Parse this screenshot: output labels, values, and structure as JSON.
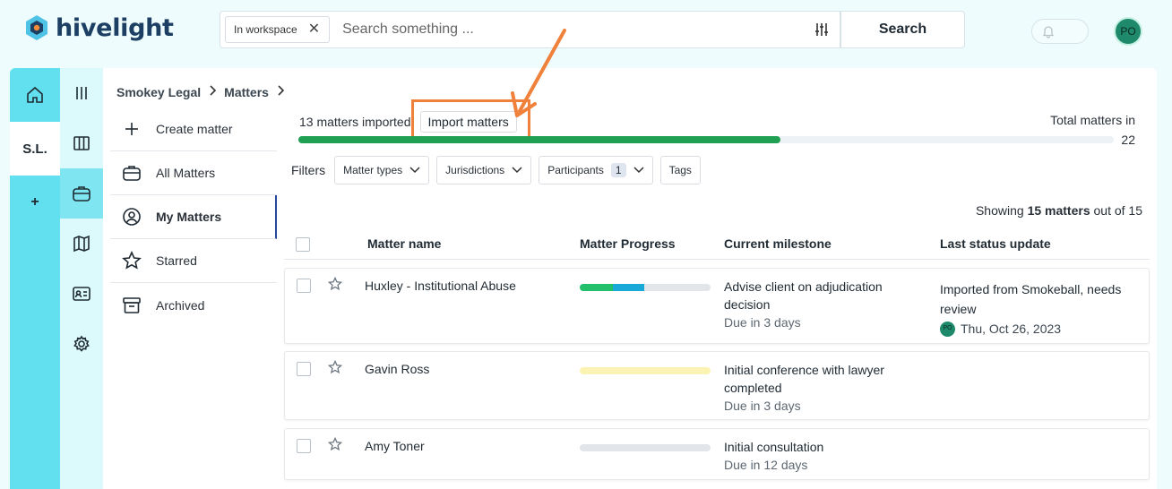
{
  "app": {
    "name": "hivelight",
    "avatar_initials": "PO"
  },
  "search": {
    "scope_chip": "In workspace",
    "placeholder": "Search something ...",
    "button_label": "Search"
  },
  "rail": {
    "workspace_label": "S.L.",
    "add_label": "+"
  },
  "breadcrumb": [
    "Smokey Legal",
    "Matters"
  ],
  "nav": [
    {
      "label": "Create matter",
      "icon": "plus-icon"
    },
    {
      "label": "All Matters",
      "icon": "briefcase-icon"
    },
    {
      "label": "My Matters",
      "icon": "user-circle-icon",
      "active": true
    },
    {
      "label": "Starred",
      "icon": "star-icon"
    },
    {
      "label": "Archived",
      "icon": "archive-icon"
    }
  ],
  "import": {
    "imported_text": "13 matters imported",
    "button_label": "Import matters",
    "total_label": "Total matters in",
    "total_value": "22",
    "imported_count": 13,
    "total_count": 22,
    "bar_color": "#1fa052"
  },
  "filters": {
    "label": "Filters",
    "chips": [
      {
        "label": "Matter types"
      },
      {
        "label": "Jurisdictions"
      },
      {
        "label": "Participants",
        "count": "1"
      },
      {
        "label": "Tags"
      }
    ]
  },
  "showing": {
    "prefix": "Showing",
    "bold": "15 matters",
    "suffix": "out of 15"
  },
  "table": {
    "columns": [
      "Matter name",
      "Matter Progress",
      "Current milestone",
      "Last status update"
    ],
    "rows": [
      {
        "name": "Huxley - Institutional Abuse",
        "progress": [
          {
            "fraction": 0.25,
            "color": "#22c06b"
          },
          {
            "fraction": 0.24,
            "color": "#1aa8d9"
          }
        ],
        "milestone": "Advise client on adjudication decision",
        "due": "Due in 3 days",
        "status": "Imported from Smokeball, needs review",
        "status_initials": "PO",
        "status_date": "Thu, Oct 26, 2023"
      },
      {
        "name": "Gavin Ross",
        "progress": [
          {
            "fraction": 1.0,
            "color": "#fbf3b3"
          }
        ],
        "milestone": "Initial conference with lawyer completed",
        "due": "Due in 3 days",
        "status": "",
        "status_initials": "",
        "status_date": ""
      },
      {
        "name": "Amy Toner",
        "progress": [],
        "milestone": "Initial consultation",
        "due": "Due in 12 days",
        "status": "",
        "status_initials": "",
        "status_date": ""
      }
    ]
  },
  "colors": {
    "accent_cyan": "#63e0ef",
    "highlight_orange": "#f0813b",
    "active_nav_border": "#25489c"
  }
}
